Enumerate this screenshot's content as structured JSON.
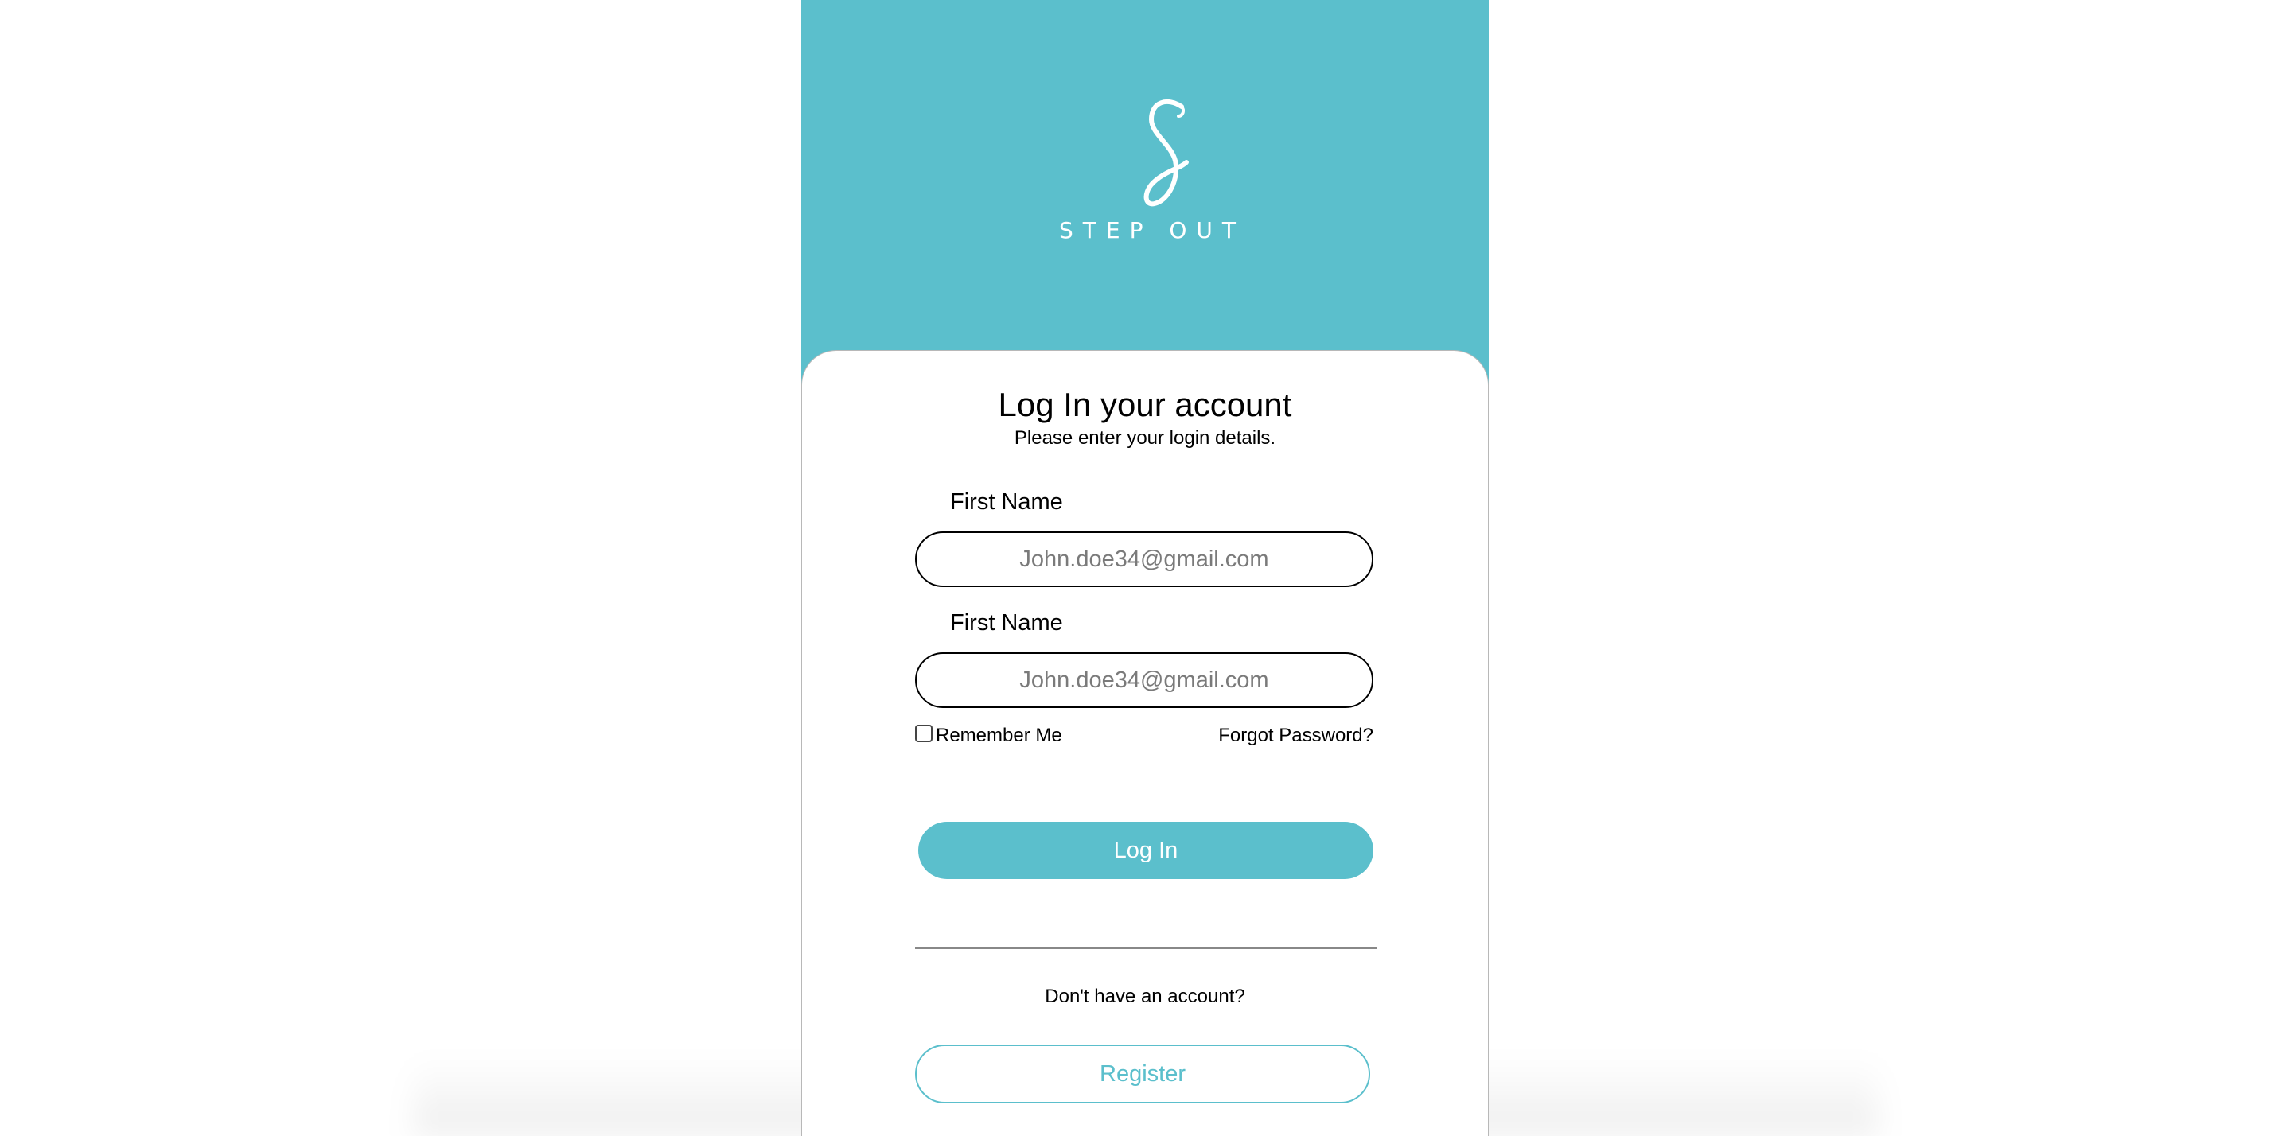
{
  "colors": {
    "brand": "#5bbfcc",
    "background": "#ffffff",
    "text": "#000000",
    "placeholder": "#7a7a7a"
  },
  "header": {
    "logo_word": "STEP OUT"
  },
  "form": {
    "title": "Log In your account",
    "subtitle": "Please enter your login details.",
    "fields": [
      {
        "label": "First Name",
        "placeholder": "John.doe34@gmail.com",
        "value": ""
      },
      {
        "label": "First Name",
        "placeholder": "John.doe34@gmail.com",
        "value": ""
      }
    ],
    "remember_label": "Remember Me",
    "remember_checked": false,
    "forgot_label": "Forgot Password?",
    "login_label": "Log In",
    "no_account_text": "Don't have an account?",
    "register_label": "Register"
  }
}
